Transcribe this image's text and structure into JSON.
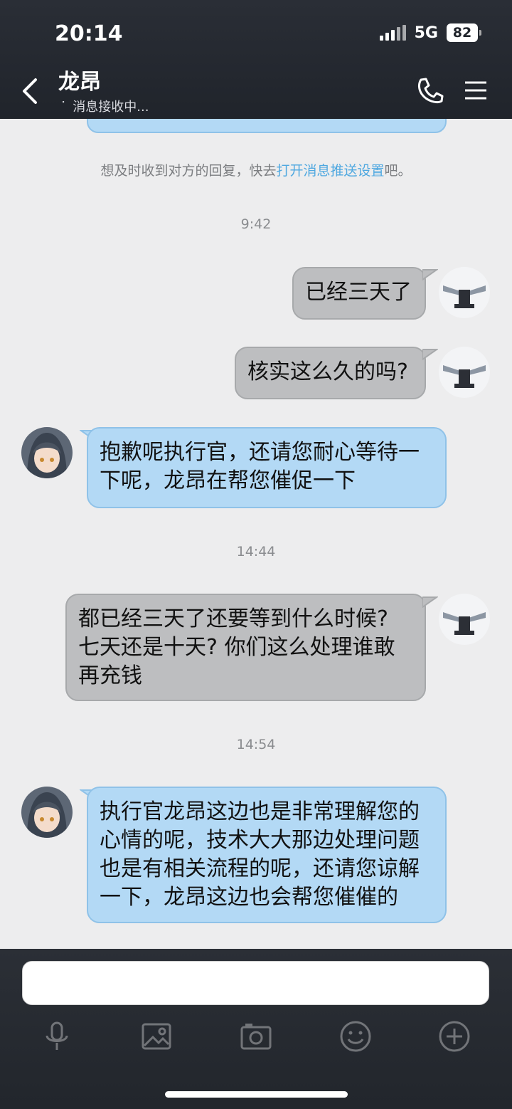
{
  "status_bar": {
    "time": "20:14",
    "network": "5G",
    "battery": "82"
  },
  "header": {
    "title": "龙昂",
    "status": "消息接收中...",
    "spinner": "⠁"
  },
  "notice": {
    "prefix": "想及时收到对方的回复，快去",
    "link": "打开消息推送设置",
    "suffix": "吧。"
  },
  "messages": [
    {
      "type": "timestamp",
      "text": "9:42"
    },
    {
      "type": "out",
      "text": "已经三天了"
    },
    {
      "type": "out",
      "text": "核实这么久的吗?"
    },
    {
      "type": "in",
      "lines": [
        "抱歉呢执行官，还请您耐心等待一",
        "下呢，龙昂在帮您催促一下"
      ]
    },
    {
      "type": "timestamp",
      "text": "14:44"
    },
    {
      "type": "out",
      "lines": [
        "都已经三天了还要等到什么时候?",
        "七天还是十天? 你们这么处理谁敢",
        "再充钱"
      ]
    },
    {
      "type": "timestamp",
      "text": "14:54"
    },
    {
      "type": "in",
      "lines": [
        "执行官龙昂这边也是非常理解您的",
        "心情的呢，技术大大那边处理问题",
        "也是有相关流程的呢，还请您谅解",
        "一下，龙昂这边也会帮您催催的"
      ]
    }
  ],
  "input": {
    "value": "",
    "placeholder": ""
  },
  "colors": {
    "bubble_in": "#b3d9f5",
    "bubble_out": "#bdbec0",
    "link": "#4fa8e0",
    "header_bg": "#20242b"
  },
  "toolbar_icons": [
    "microphone-icon",
    "image-icon",
    "camera-icon",
    "emoji-icon",
    "plus-icon"
  ]
}
